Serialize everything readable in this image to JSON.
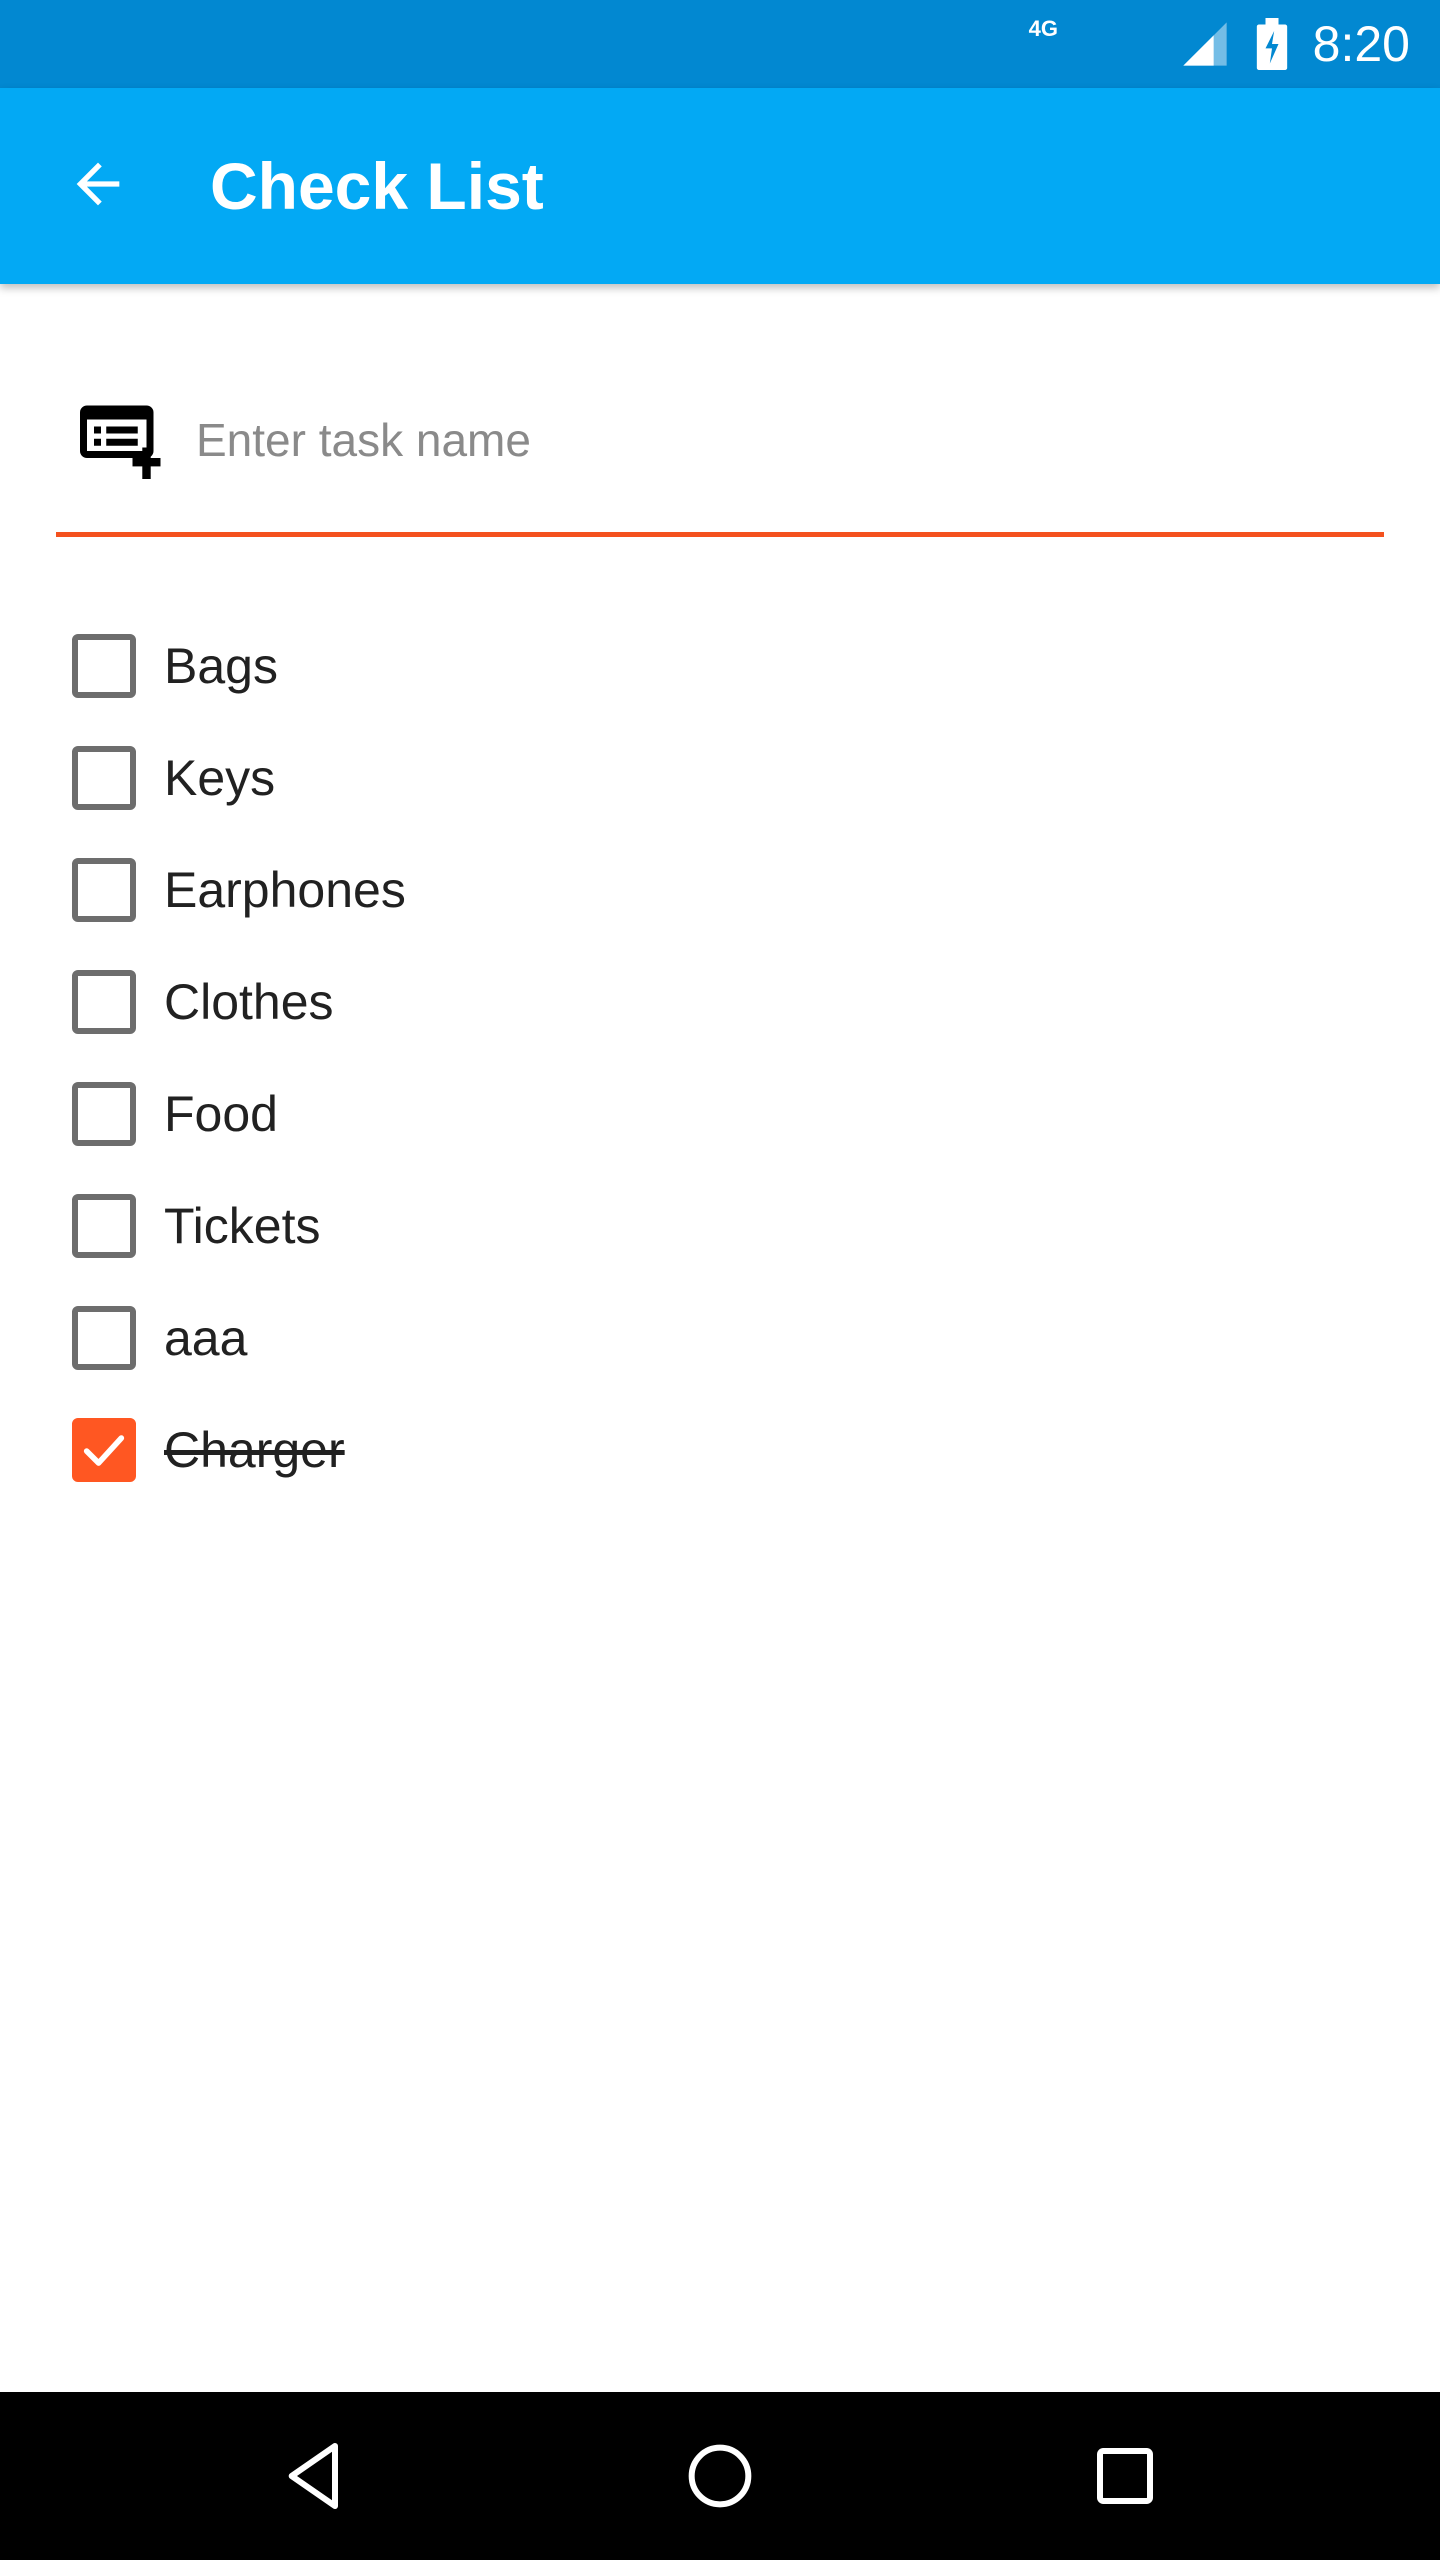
{
  "status_bar": {
    "network": "4G",
    "time": "8:20",
    "icons": [
      "signal-icon",
      "battery-charging-icon"
    ]
  },
  "app_bar": {
    "title": "Check List",
    "back_icon": "arrow-back-icon"
  },
  "task_input": {
    "placeholder": "Enter task name",
    "value": "",
    "icon": "playlist-add-icon"
  },
  "checklist": {
    "items": [
      {
        "label": "Bags",
        "checked": false
      },
      {
        "label": "Keys",
        "checked": false
      },
      {
        "label": "Earphones",
        "checked": false
      },
      {
        "label": "Clothes",
        "checked": false
      },
      {
        "label": "Food",
        "checked": false
      },
      {
        "label": "Tickets",
        "checked": false
      },
      {
        "label": "aaa",
        "checked": false
      },
      {
        "label": "Charger",
        "checked": true
      }
    ]
  },
  "nav_bar": {
    "icons": [
      "nav-back-icon",
      "nav-home-icon",
      "nav-recents-icon"
    ]
  },
  "colors": {
    "status_bar": "#0288d1",
    "app_bar": "#03a9f4",
    "accent": "#ff5722",
    "underline": "#f4511e"
  }
}
